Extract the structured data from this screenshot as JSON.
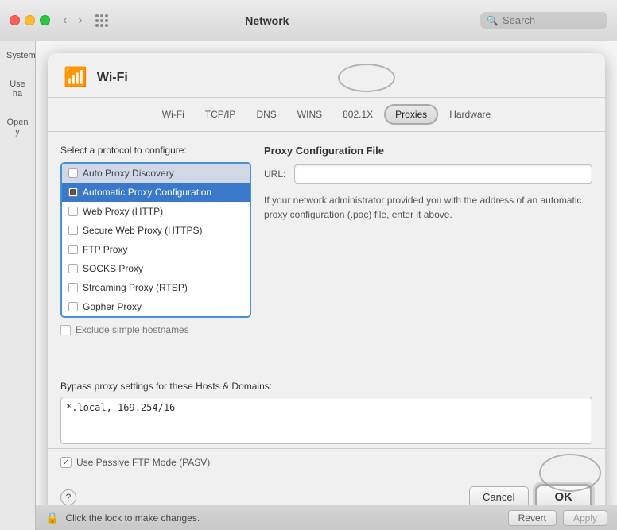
{
  "titlebar": {
    "title": "Network",
    "search_placeholder": "Search"
  },
  "sidebar": {
    "items": [
      "System",
      "Use ha",
      "Open y"
    ]
  },
  "panel": {
    "wifi_label": "Wi-Fi",
    "tabs": [
      "Wi-Fi",
      "TCP/IP",
      "DNS",
      "WINS",
      "802.1X",
      "Proxies",
      "Hardware"
    ],
    "active_tab": "Proxies",
    "protocol_section_label": "Select a protocol to configure:",
    "protocols": [
      {
        "label": "Auto Proxy Discovery",
        "checked": false
      },
      {
        "label": "Automatic Proxy Configuration",
        "checked": true,
        "selected": true
      },
      {
        "label": "Web Proxy (HTTP)",
        "checked": false
      },
      {
        "label": "Secure Web Proxy (HTTPS)",
        "checked": false
      },
      {
        "label": "FTP Proxy",
        "checked": false
      },
      {
        "label": "SOCKS Proxy",
        "checked": false
      },
      {
        "label": "Streaming Proxy (RTSP)",
        "checked": false
      },
      {
        "label": "Gopher Proxy",
        "checked": false
      }
    ],
    "exclude_label": "Exclude simple hostnames",
    "proxy_config_title": "Proxy Configuration File",
    "url_label": "URL:",
    "url_value": "",
    "info_text": "If your network administrator provided you with the address of an automatic proxy configuration (.pac) file, enter it above.",
    "bypass_label": "Bypass proxy settings for these Hosts & Domains:",
    "bypass_value": "*.local, 169.254/16",
    "passive_ftp_label": "Use Passive FTP Mode (PASV)",
    "cancel_label": "Cancel",
    "ok_label": "OK",
    "help_label": "?",
    "lock_text": "Click the lock to make changes.",
    "revert_label": "Revert",
    "apply_label": "Apply"
  }
}
